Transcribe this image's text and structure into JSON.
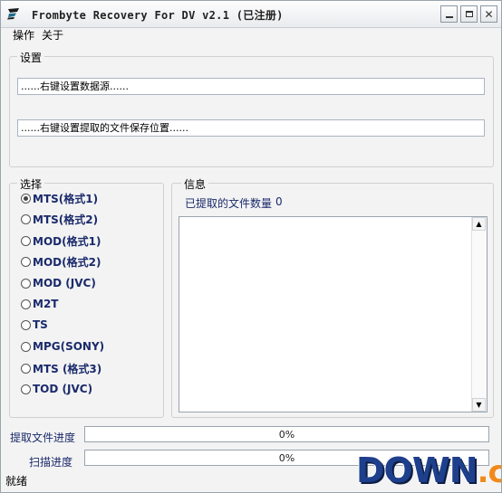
{
  "window": {
    "title": "Frombyte Recovery For DV v2.1 (已注册)",
    "icon": "app-logo-icon",
    "buttons": {
      "minimize": "minimize-icon",
      "maximize": "maximize-icon",
      "close": "close-icon"
    }
  },
  "menu": {
    "items": [
      {
        "label": "操作"
      },
      {
        "label": "关于"
      }
    ]
  },
  "settings": {
    "legend": "设置",
    "source_path": "......右键设置数据源......",
    "save_path": "......右键设置提取的文件保存位置......"
  },
  "select": {
    "legend": "选择",
    "options": [
      {
        "label": "MTS(格式1)",
        "checked": true
      },
      {
        "label": "MTS(格式2)",
        "checked": false
      },
      {
        "label": "MOD(格式1)",
        "checked": false
      },
      {
        "label": "MOD(格式2)",
        "checked": false
      },
      {
        "label": "MOD (JVC)",
        "checked": false
      },
      {
        "label": "M2T",
        "checked": false
      },
      {
        "label": "TS",
        "checked": false
      },
      {
        "label": "MPG(SONY)",
        "checked": false
      },
      {
        "label": "MTS (格式3)",
        "checked": false
      },
      {
        "label": "TOD (JVC)",
        "checked": false
      }
    ]
  },
  "info": {
    "legend": "信息",
    "count_label": "已提取的文件数量",
    "count_value": "0",
    "log_text": ""
  },
  "progress": {
    "extract": {
      "label": "提取文件进度",
      "text": "0%",
      "value": 0
    },
    "scan": {
      "label": "扫描进度",
      "text": "0%",
      "value": 0
    }
  },
  "status": {
    "text": "就绪"
  },
  "watermark": {
    "down": "DOWN",
    "cc": ".cc"
  },
  "colors": {
    "label_blue": "#1a2a6b",
    "accent": "#3f7fd6"
  }
}
